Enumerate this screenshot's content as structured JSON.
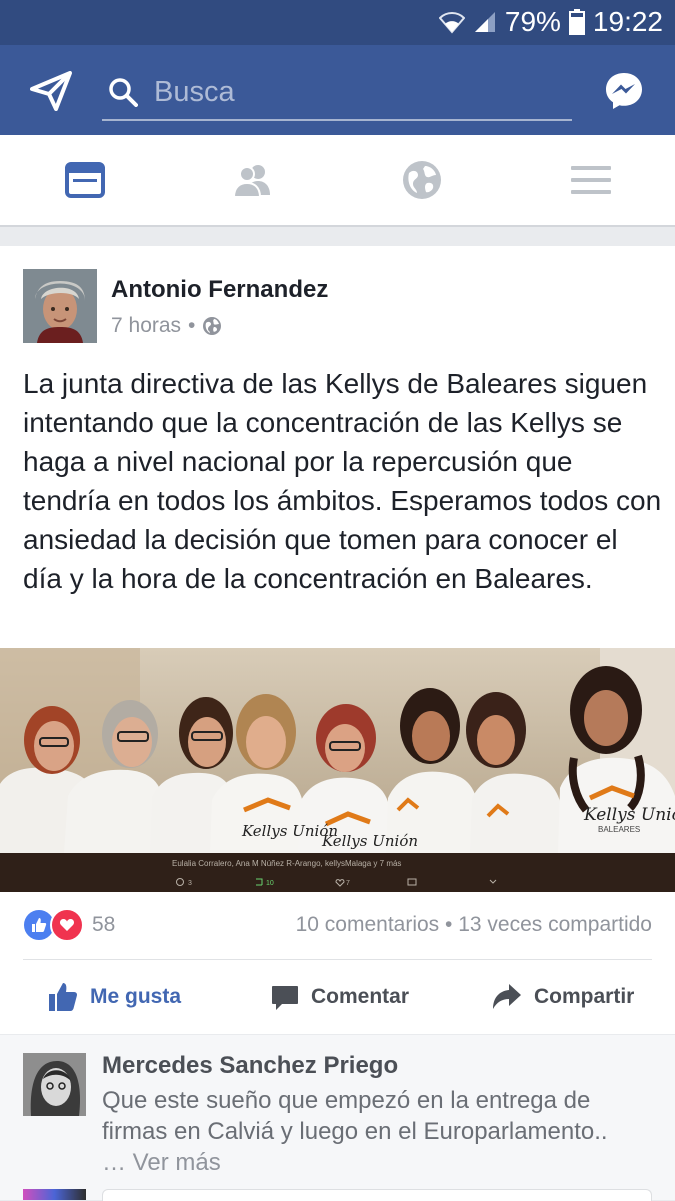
{
  "status": {
    "battery": "79%",
    "time": "19:22"
  },
  "search": {
    "placeholder": "Busca"
  },
  "tabs": [
    {
      "icon": "news-feed-icon",
      "active": true
    },
    {
      "icon": "friends-icon",
      "active": false
    },
    {
      "icon": "globe-icon",
      "active": false
    },
    {
      "icon": "menu-icon",
      "active": false
    }
  ],
  "post": {
    "author": "Antonio Fernandez",
    "time": "7 horas",
    "privacy_icon": "globe-icon",
    "text": "La junta directiva de las Kellys de Baleares siguen intentando que la concentración de las Kellys se haga a nivel nacional por la repercusión que tendría en todos los ámbitos. Esperamos todos con ansiedad la decisión que tomen para conocer el día y la hora de la concentración en Baleares.",
    "photo": {
      "caption": "Eulalia Corralero, Ana M Núñez R-Arango, kellysMalaga y 7 más",
      "stats": [
        "3",
        "10",
        "7"
      ],
      "shirt_text": "Kellys Unión",
      "shirt_sub": "BALEARES"
    },
    "reaction_count": "58",
    "comments_count": "10 comentarios",
    "shares_count": "13 veces compartido",
    "separator": "•",
    "actions": {
      "like": "Me gusta",
      "comment": "Comentar",
      "share": "Compartir"
    }
  },
  "comment": {
    "author": "Mercedes Sanchez Priego",
    "text": "Que este sueño que empezó en la entrega de firmas en Calviá y luego en el Europarlamento..",
    "ellipsis": "…",
    "see_more": "Ver más"
  },
  "colors": {
    "brand": "#3b5998",
    "status_bar": "#314b80",
    "like_blue": "#4c7ff0",
    "love_red": "#f0334f"
  }
}
